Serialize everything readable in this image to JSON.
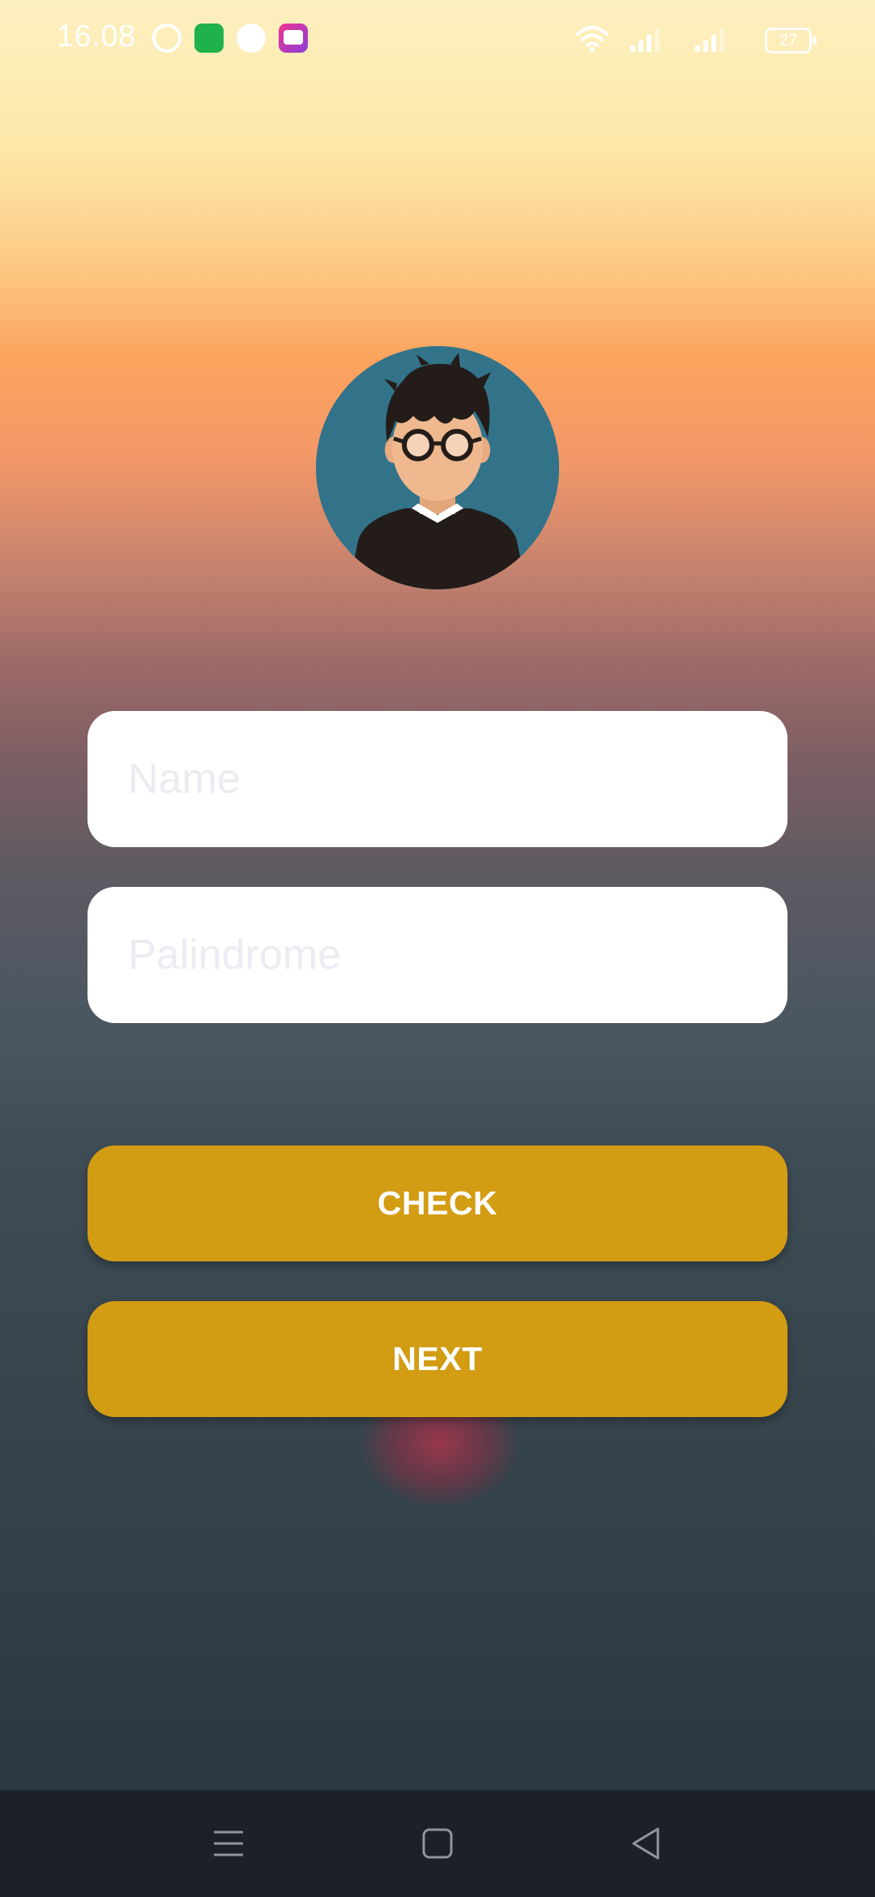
{
  "status_bar": {
    "time": "16.08",
    "battery_level": "27",
    "notification_icons": [
      "whatsapp-icon",
      "shop-app-icon",
      "pill-app-icon",
      "lazada-icon"
    ],
    "system_icons": [
      "wifi-icon",
      "signal-icon-sim1",
      "signal-icon-sim2",
      "battery-icon"
    ]
  },
  "profile": {
    "avatar_icon": "user-avatar-icon"
  },
  "form": {
    "name_placeholder": "Name",
    "name_value": "",
    "palindrome_placeholder": "Palindrome",
    "palindrome_value": ""
  },
  "buttons": {
    "check_label": "CHECK",
    "next_label": "NEXT"
  },
  "navigation": {
    "items": [
      "menu-icon",
      "home-icon",
      "back-icon"
    ]
  },
  "colors": {
    "button": "#d29c13",
    "field": "#ffffff",
    "placeholder": "#ecebf2",
    "avatar_bg": "#32738a",
    "nav_bar": "#1b2127"
  }
}
